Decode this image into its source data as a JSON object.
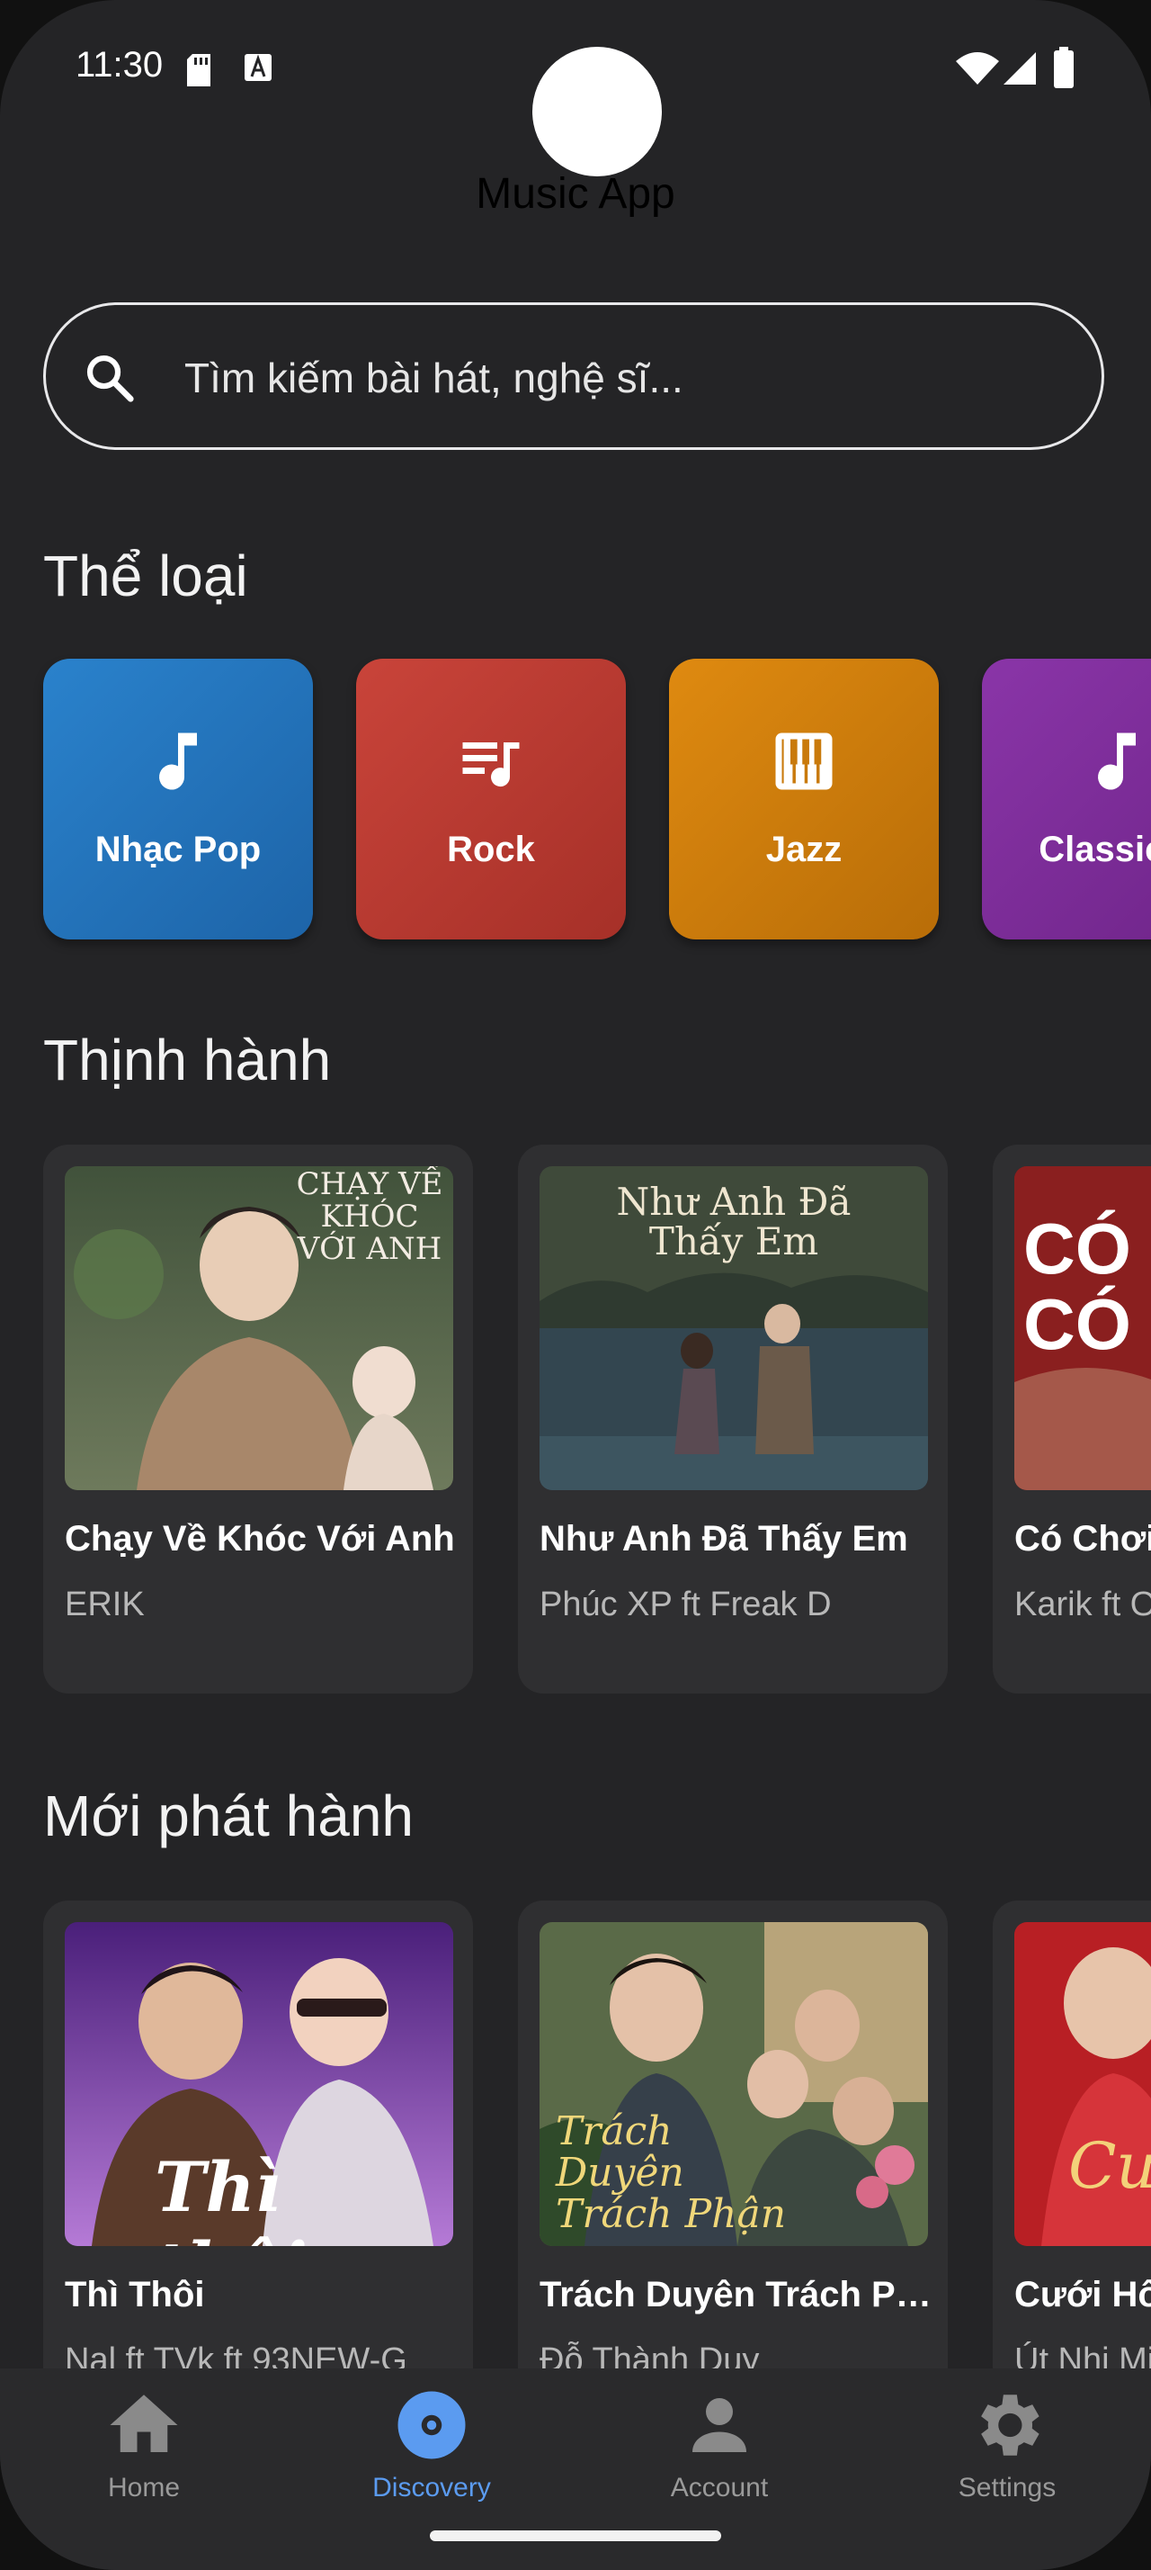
{
  "status_bar": {
    "time": "11:30"
  },
  "app_bar": {
    "title": "Music App"
  },
  "search": {
    "placeholder": "Tìm kiếm bài hát, nghệ sĩ..."
  },
  "categories": {
    "title": "Thể loại",
    "items": [
      {
        "label": "Nhạc Pop",
        "icon": "music-note-icon",
        "color": "#1f6fb4"
      },
      {
        "label": "Rock",
        "icon": "queue-music-icon",
        "color": "#b8372f"
      },
      {
        "label": "Jazz",
        "icon": "piano-icon",
        "color": "#cf7a0b"
      },
      {
        "label": "Classical",
        "icon": "music-note-icon",
        "color": "#7a2b96"
      }
    ]
  },
  "trending": {
    "title": "Thịnh hành",
    "items": [
      {
        "title": "Chạy Về Khóc Với Anh",
        "artist": "ERIK",
        "art_text": "CHẠY VỀ KHÓC VỚI ANH"
      },
      {
        "title": "Như Anh Đã Thấy Em",
        "artist": "Phúc XP ft Freak D",
        "art_text": "Như Anh Đã Thấy Em"
      },
      {
        "title": "Có Chơi Có Chịu",
        "artist": "Karik ft Only C",
        "art_text": "CÓ CHƠI CÓ CHỊU"
      }
    ]
  },
  "new_releases": {
    "title": "Mới phát hành",
    "items": [
      {
        "title": "Thì Thôi",
        "artist": "Nal ft TVk ft 93NEW-G",
        "art_text": "Thì thôi"
      },
      {
        "title": "Trách Duyên Trách Phận",
        "artist": "Đỗ Thành Duy",
        "art_text": "Trách Duyên Trách Phận"
      },
      {
        "title": "Cưới Hông Chốt Nha",
        "artist": "Út Nhị Mino",
        "art_text": "Cưới"
      }
    ]
  },
  "bottom_nav": {
    "accent": "#5b9bf0",
    "items": [
      {
        "label": "Home",
        "icon": "home-icon",
        "active": false
      },
      {
        "label": "Discovery",
        "icon": "discovery-icon",
        "active": true
      },
      {
        "label": "Account",
        "icon": "account-icon",
        "active": false
      },
      {
        "label": "Settings",
        "icon": "settings-icon",
        "active": false
      }
    ]
  }
}
